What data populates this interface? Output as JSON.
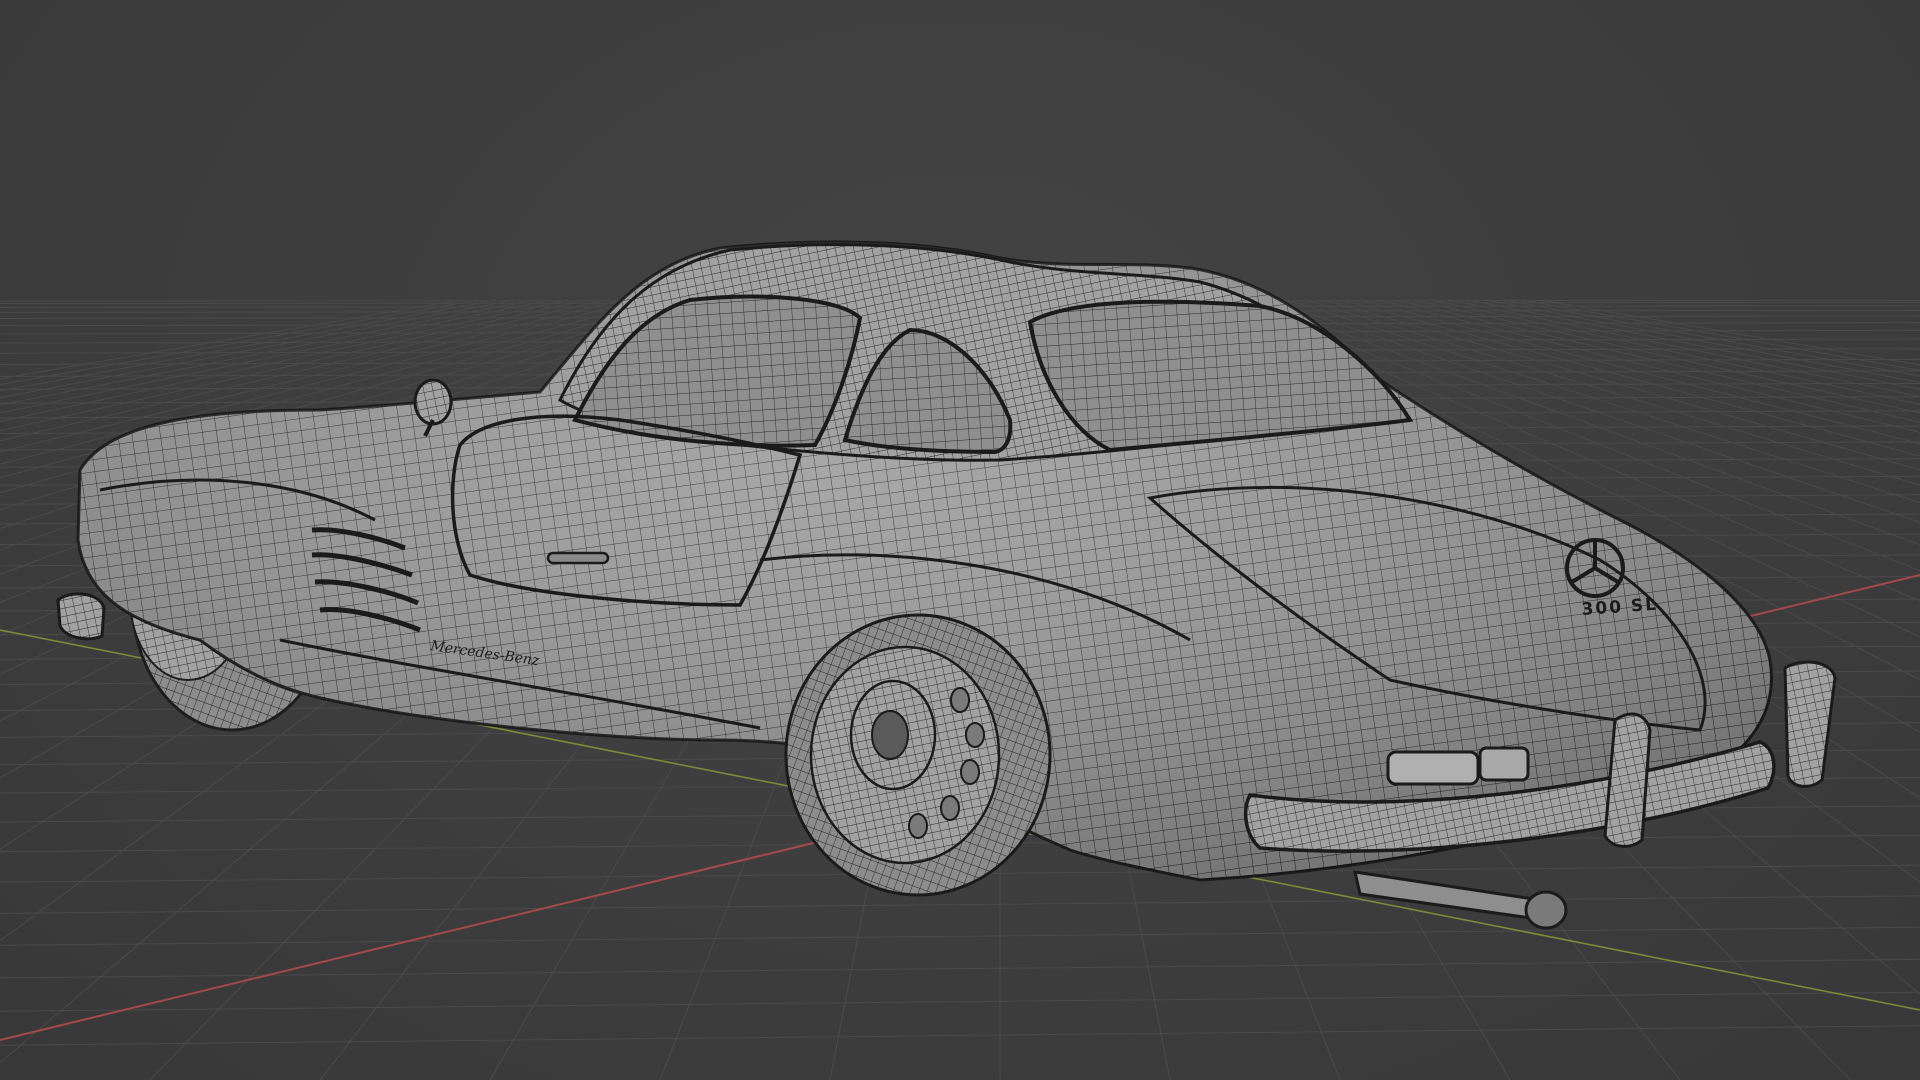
{
  "viewport": {
    "mode": "3D viewport",
    "shading": "solid-wireframe",
    "background_color": "#3d3d3d",
    "grid_color": "#4a4a4a",
    "x_axis_color": "#a34a4a",
    "y_axis_color": "#7a8a3a",
    "wire_color": "#1e1e1e",
    "mesh_color": "#9a9a9a"
  },
  "model": {
    "subject": "car",
    "badge_text": "300 SL",
    "side_script_text": "Mercedes-Benz"
  }
}
